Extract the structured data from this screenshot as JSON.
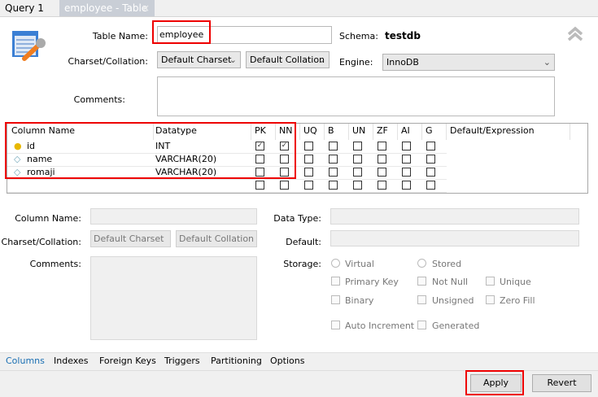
{
  "tabs": [
    {
      "label": "Query 1"
    },
    {
      "label": "employee - Table",
      "close": "×"
    }
  ],
  "form": {
    "table_name_label": "Table Name:",
    "table_name": "employee",
    "schema_label": "Schema:",
    "schema": "testdb",
    "charset_label": "Charset/Collation:",
    "charset": "Default Charset",
    "collation": "Default Collation",
    "engine_label": "Engine:",
    "engine": "InnoDB",
    "comments_label": "Comments:"
  },
  "grid": {
    "headers": [
      "Column Name",
      "Datatype",
      "PK",
      "NN",
      "UQ",
      "B",
      "UN",
      "ZF",
      "AI",
      "G",
      "Default/Expression"
    ],
    "rows": [
      {
        "name": "id",
        "type": "INT",
        "pk": true,
        "nn": true,
        "icon": "key-icon"
      },
      {
        "name": "name",
        "type": "VARCHAR(20)",
        "pk": false,
        "nn": false,
        "icon": "diamond-icon"
      },
      {
        "name": "romaji",
        "type": "VARCHAR(20)",
        "pk": false,
        "nn": false,
        "icon": "diamond-icon"
      }
    ]
  },
  "detail": {
    "column_name_label": "Column Name:",
    "charset_label": "Charset/Collation:",
    "charset": "Default Charset",
    "collation": "Default Collation",
    "comments_label": "Comments:",
    "data_type_label": "Data Type:",
    "default_label": "Default:",
    "storage_label": "Storage:",
    "virtual": "Virtual",
    "stored": "Stored",
    "primary_key": "Primary Key",
    "not_null": "Not Null",
    "unique": "Unique",
    "binary": "Binary",
    "unsigned": "Unsigned",
    "zero_fill": "Zero Fill",
    "auto_increment": "Auto Increment",
    "generated": "Generated"
  },
  "bottom_tabs": [
    "Columns",
    "Indexes",
    "Foreign Keys",
    "Triggers",
    "Partitioning",
    "Options"
  ],
  "buttons": {
    "apply": "Apply",
    "revert": "Revert"
  },
  "colors": {
    "accent": "#1a6fb3",
    "highlight": "#e00000"
  }
}
